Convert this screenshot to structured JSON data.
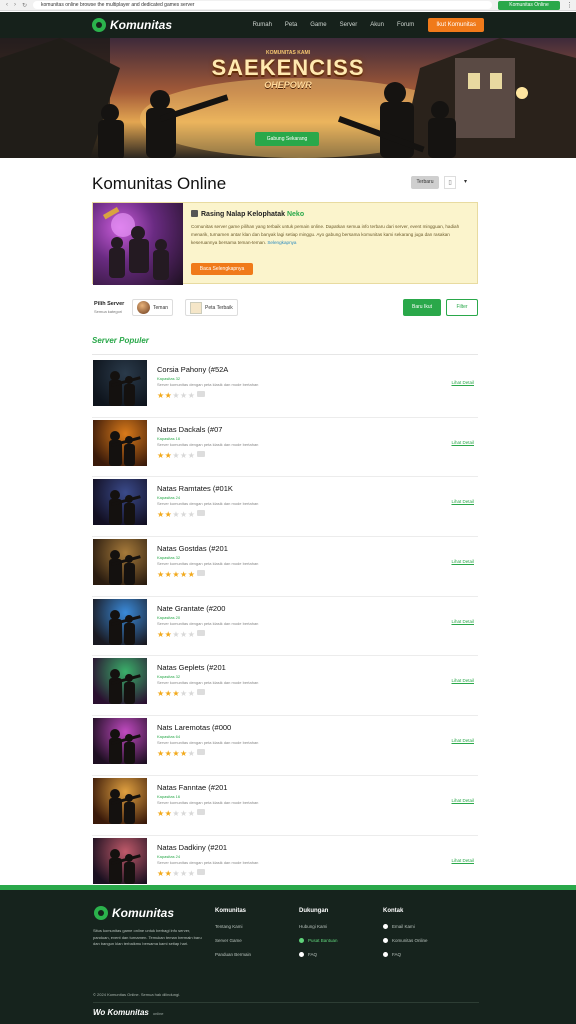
{
  "browser": {
    "url": "komunitas online browse the multiplayer and dedicated games server",
    "extension_label": "Komunitas Online"
  },
  "nav": {
    "brand": "Komunitas",
    "menu": [
      "Rumah",
      "Peta",
      "Game",
      "Server",
      "Akun",
      "Forum"
    ],
    "cta": "Ikut Komunitas"
  },
  "hero": {
    "overline": "KOMUNITAS KAMI",
    "title": "SAEKENCISS",
    "subtitle": "OHEPOWR",
    "cta": "Gabung Sekarang"
  },
  "page": {
    "title": "Komunitas Online",
    "sort_label": "Terbaru",
    "view_icon": "grid-icon"
  },
  "featured": {
    "title_prefix": "Rasing Nalap Kelophatak",
    "title_highlight": "Neko",
    "text": "Comunitas server game pilihan yang terbaik untuk pemain online. Dapatkan semua info terbaru dari server, event mingguan, hadiah menarik, turnamen antar klan dan banyak lagi setiap minggu. Ayo gabung bersama komunitas kami sekarang juga dan rasakan keseruannya bersama teman-teman.",
    "link_text": "Selengkapnya",
    "cta": "Baca Selengkapnya"
  },
  "filters": {
    "label": "Pilih Server",
    "sublabel": "Semua kategori",
    "chip1": "Teman",
    "chip2": "Peta Terbaik",
    "green_btn": "Baru Ikut",
    "outline_btn": "Filter"
  },
  "section": {
    "title": "Server Populer"
  },
  "rows": [
    {
      "title": "Corsia Pahony (#52A",
      "sub": "Kapasitas 32",
      "desc": "Server komunitas dengan peta klasik dan mode bertahan",
      "stars": 2,
      "link": "Lihat Detail"
    },
    {
      "title": "Natas Dackals (#07",
      "sub": "Kapasitas 16",
      "desc": "Server komunitas dengan peta klasik dan mode bertahan",
      "stars": 2,
      "link": "Lihat Detail"
    },
    {
      "title": "Natas Ramtates (#01K",
      "sub": "Kapasitas 24",
      "desc": "Server komunitas dengan peta klasik dan mode bertahan",
      "stars": 2,
      "link": "Lihat Detail"
    },
    {
      "title": "Natas Gostdas (#201",
      "sub": "Kapasitas 32",
      "desc": "Server komunitas dengan peta klasik dan mode bertahan",
      "stars": 5,
      "link": "Lihat Detail"
    },
    {
      "title": "Nate Grantate (#200",
      "sub": "Kapasitas 20",
      "desc": "Server komunitas dengan peta klasik dan mode bertahan",
      "stars": 2,
      "link": "Lihat Detail"
    },
    {
      "title": "Natas Geplets (#201",
      "sub": "Kapasitas 32",
      "desc": "Server komunitas dengan peta klasik dan mode bertahan",
      "stars": 3,
      "link": "Lihat Detail"
    },
    {
      "title": "Nats Laremotas (#000",
      "sub": "Kapasitas 64",
      "desc": "Server komunitas dengan peta klasik dan mode bertahan",
      "stars": 4,
      "link": "Lihat Detail"
    },
    {
      "title": "Natas Fanntae (#201",
      "sub": "Kapasitas 16",
      "desc": "Server komunitas dengan peta klasik dan mode bertahan",
      "stars": 2,
      "link": "Lihat Detail"
    },
    {
      "title": "Natas Dadkiny (#201",
      "sub": "Kapasitas 24",
      "desc": "Server komunitas dengan peta klasik dan mode bertahan",
      "stars": 2,
      "link": "Lihat Detail"
    }
  ],
  "footer": {
    "brand": "Komunitas",
    "about": "Situs komunitas game online untuk berbagi info server, panduan, event dan turnamen. Temukan teman bermain baru dan bangun klan terbaikmu bersama kami setiap hari.",
    "col1": {
      "heading": "Komunitas",
      "items": [
        "Tentang Kami",
        "Server Game",
        "Panduan Bermain"
      ]
    },
    "col2": {
      "heading": "Dukungan",
      "items": [
        "Hubungi Kami",
        "Pusat Bantuan",
        "FAQ"
      ]
    },
    "col3": {
      "heading": "Kontak",
      "items": [
        "Email Kami",
        "Komunitas Online",
        "FAQ"
      ]
    },
    "copyright": "© 2024 Komunitas Online. Semua hak dilindungi.",
    "bottom_brand": "Wo Komunitas",
    "bottom_tag": "online"
  },
  "colors": {
    "accent": "#2aa84a",
    "cta": "#f07a1a",
    "nav_bg": "#16211b",
    "star": "#f2a91c"
  }
}
